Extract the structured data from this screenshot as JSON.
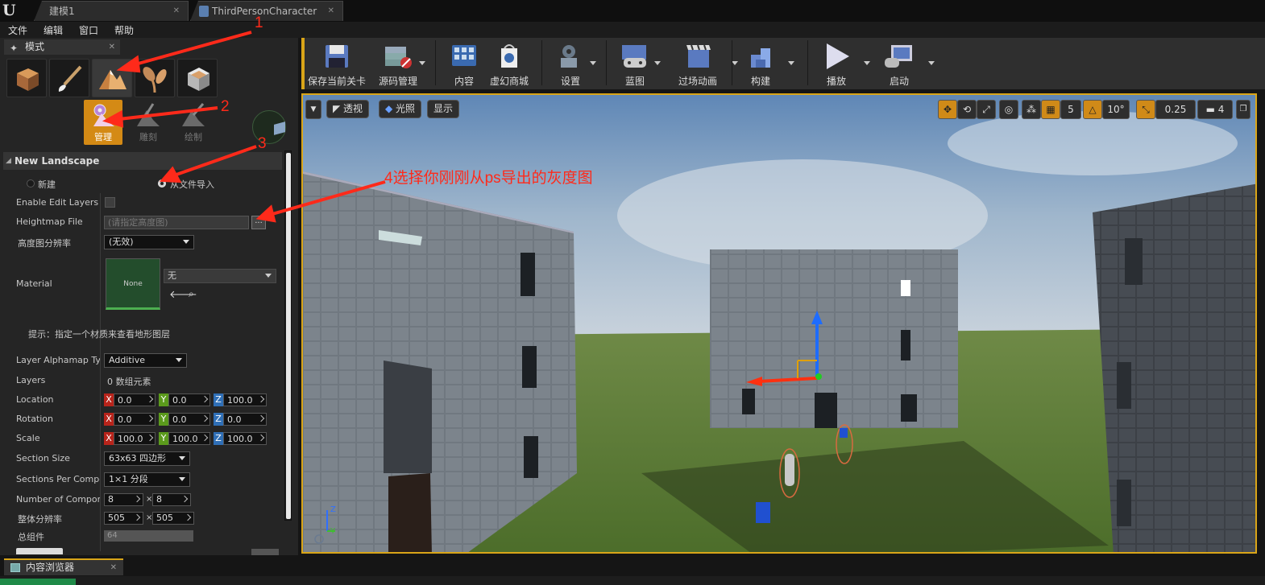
{
  "tabs": [
    {
      "label": "建模1"
    },
    {
      "label": "ThirdPersonCharacter"
    }
  ],
  "menu": [
    "文件",
    "编辑",
    "窗口",
    "帮助"
  ],
  "modes_panel": {
    "title": "模式",
    "mode_icons": [
      "place-icon",
      "paint-icon",
      "landscape-icon",
      "foliage-icon",
      "geometry-icon"
    ],
    "tools": [
      {
        "label": "管理",
        "active": true
      },
      {
        "label": "雕刻",
        "active": false
      },
      {
        "label": "绘制",
        "active": false
      }
    ],
    "section_title": "New Landscape",
    "radio_new": "新建",
    "radio_import": "从文件导入",
    "selected_radio": "从文件导入",
    "enable_edit_layers": {
      "label": "Enable Edit Layers",
      "checked": false
    },
    "heightmap_file": {
      "label": "Heightmap File",
      "placeholder": "(请指定高度图)",
      "browse": "..."
    },
    "heightmap_res": {
      "label": "高度图分辨率",
      "value": "(无效)"
    },
    "material": {
      "label": "Material",
      "thumb": "None",
      "value": "无"
    },
    "hint": "提示：指定一个材质来查看地形图层",
    "layer_alphamap": {
      "label": "Layer Alphamap Type",
      "value": "Additive"
    },
    "layers": {
      "label": "Layers",
      "value": "0 数组元素"
    },
    "location": {
      "label": "Location",
      "x": "0.0",
      "y": "0.0",
      "z": "100.0"
    },
    "rotation": {
      "label": "Rotation",
      "x": "0.0",
      "y": "0.0",
      "z": "0.0"
    },
    "scale": {
      "label": "Scale",
      "x": "100.0",
      "y": "100.0",
      "z": "100.0"
    },
    "section_size": {
      "label": "Section Size",
      "value": "63x63 四边形"
    },
    "sections_per_component": {
      "label": "Sections Per Component",
      "value": "1×1 分段"
    },
    "num_components": {
      "label": "Number of Components",
      "a": "8",
      "b": "8",
      "sep": "×"
    },
    "overall_resolution": {
      "label": "整体分辨率",
      "a": "505",
      "b": "505",
      "sep": "×"
    },
    "total_components": {
      "label": "总组件",
      "value": "64"
    }
  },
  "toolbar": [
    {
      "label": "保存当前关卡",
      "icon": "save-icon"
    },
    {
      "label": "源码管理",
      "icon": "source-control-icon"
    },
    {
      "label": "内容",
      "icon": "content-icon"
    },
    {
      "label": "虚幻商城",
      "icon": "marketplace-icon"
    },
    {
      "label": "设置",
      "icon": "settings-icon"
    },
    {
      "label": "蓝图",
      "icon": "blueprint-icon"
    },
    {
      "label": "过场动画",
      "icon": "cinematics-icon"
    },
    {
      "label": "构建",
      "icon": "build-icon"
    },
    {
      "label": "播放",
      "icon": "play-icon"
    },
    {
      "label": "启动",
      "icon": "launch-icon"
    }
  ],
  "viewport": {
    "perspective": "透视",
    "lit": "光照",
    "show": "显示",
    "grid_snap": "5",
    "rotation_snap": "10°",
    "scale_snap": "0.25",
    "camera_speed": "4"
  },
  "annotations": {
    "n1": "1",
    "n2": "2",
    "n3": "3",
    "note4": "4选择你刚刚从ps导出的灰度图",
    "color": "#ff2a1a"
  },
  "content_browser": {
    "title": "内容浏览器"
  }
}
